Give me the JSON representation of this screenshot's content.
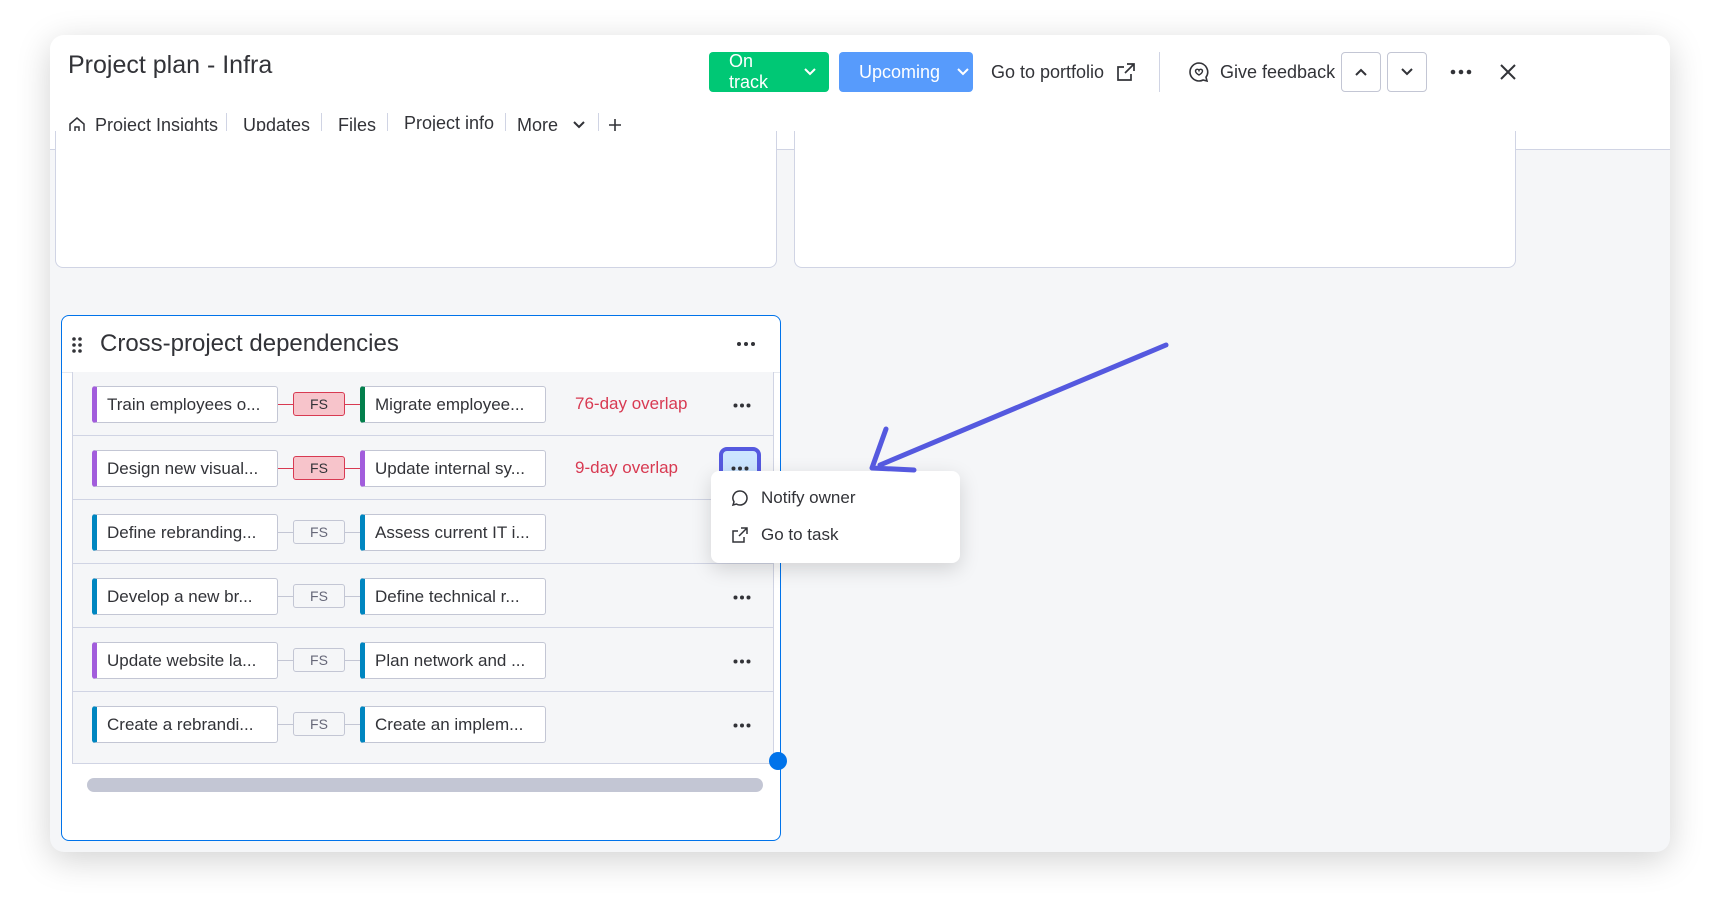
{
  "header": {
    "title": "Project plan - Infra",
    "status_label": "On track",
    "phase_label": "Upcoming",
    "portfolio_label": "Go to portfolio",
    "feedback_label": "Give feedback"
  },
  "tabs": [
    {
      "label": "Project Insights",
      "icon": "home-icon"
    },
    {
      "label": "Updates"
    },
    {
      "label": "Files"
    },
    {
      "label": "Project info",
      "active": true
    },
    {
      "label": "More"
    }
  ],
  "dependencies": {
    "title": "Cross-project dependencies",
    "rows": [
      {
        "from": "Train employees o...",
        "type": "FS",
        "to": "Migrate employee...",
        "overlap": "76-day overlap",
        "conflict": true
      },
      {
        "from": "Design new visual...",
        "type": "FS",
        "to": "Update internal sy...",
        "overlap": "9-day overlap",
        "conflict": true
      },
      {
        "from": "Define rebranding...",
        "type": "FS",
        "to": "Assess current IT i...",
        "overlap": "",
        "conflict": false
      },
      {
        "from": "Develop a new br...",
        "type": "FS",
        "to": "Define technical r...",
        "overlap": "",
        "conflict": false
      },
      {
        "from": "Update website la...",
        "type": "FS",
        "to": "Plan network and ...",
        "overlap": "",
        "conflict": false
      },
      {
        "from": "Create a rebrandi...",
        "type": "FS",
        "to": "Create an implem...",
        "overlap": "",
        "conflict": false
      }
    ]
  },
  "context_menu": {
    "items": [
      {
        "label": "Notify owner",
        "icon": "chat-bubble-icon"
      },
      {
        "label": "Go to task",
        "icon": "external-link-icon"
      }
    ]
  },
  "colors": {
    "green": "#00c875",
    "blue": "#579bfc",
    "accent": "#0073ea",
    "purple_group": "#a25ddc",
    "blue_group": "#0086c0",
    "green_group": "#037f4c",
    "conflict_red": "#d83a52",
    "arrow": "#5559df"
  }
}
